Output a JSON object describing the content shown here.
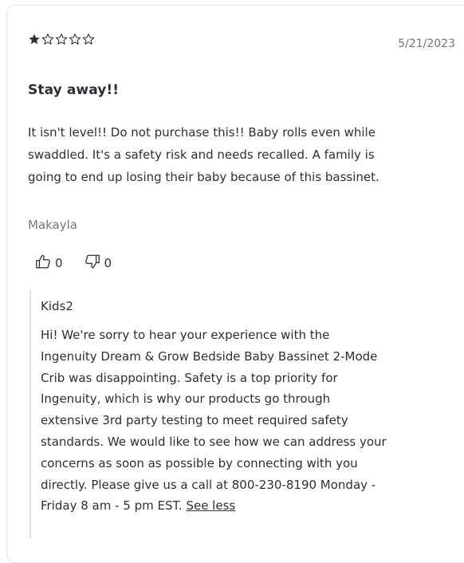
{
  "review": {
    "rating": 1,
    "max_rating": 5,
    "date": "5/21/2023",
    "title": "Stay away!!",
    "text_lines": [
      "It isn't level!! Do not purchase this!! Baby rolls even while",
      "swaddled. It's a safety risk and needs recalled. A family is",
      "going to end up losing their baby because of this bassinet."
    ],
    "author": "Makayla",
    "helpful_count": "0",
    "unhelpful_count": "0"
  },
  "response": {
    "author": "Kids2",
    "text_lines": [
      "Hi! We're sorry to hear your experience with the",
      "Ingenuity Dream & Grow Bedside Baby Bassinet 2-Mode",
      "Crib was disappointing. Safety is a top priority for",
      "Ingenuity, which is why our products go through",
      "extensive 3rd party testing to meet required safety",
      "standards. We would like to see how we can address your",
      "concerns as soon as possible by connecting with you",
      "directly. Please give us a call at 800-230-8190 Monday -",
      "Friday 8 am - 5 pm EST."
    ],
    "see_less_label": "See less"
  },
  "colors": {
    "text": "#2e2f32",
    "muted": "#74767c",
    "border": "#e3e4e5"
  },
  "icons": {
    "filled_star": "star-filled-icon",
    "empty_star": "star-outline-icon",
    "thumbs_up": "thumbs-up-icon",
    "thumbs_down": "thumbs-down-icon"
  }
}
